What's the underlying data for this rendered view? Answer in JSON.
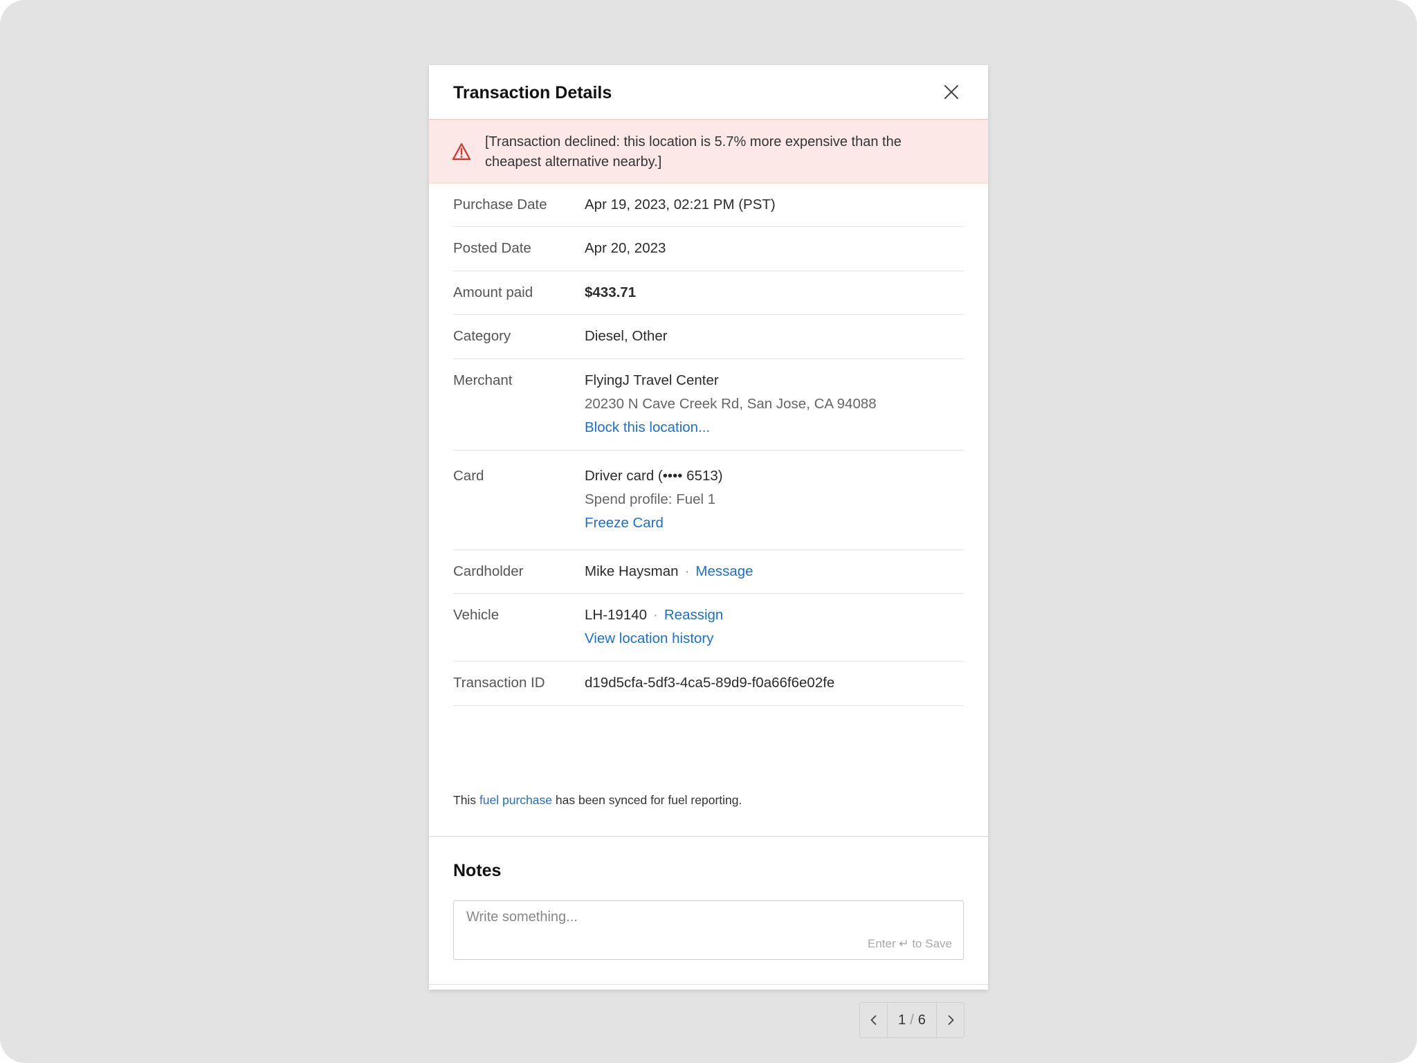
{
  "modal": {
    "title": "Transaction Details",
    "close_icon": "close-icon"
  },
  "alert": {
    "icon": "warning-triangle-icon",
    "text": "[Transaction declined: this location is 5.7% more expensive than the cheapest alternative nearby.]",
    "color": "#d93025"
  },
  "details": {
    "purchase_date": {
      "label": "Purchase Date",
      "value": "Apr 19, 2023, 02:21 PM (PST)"
    },
    "posted_date": {
      "label": "Posted Date",
      "value": "Apr 20, 2023"
    },
    "amount_paid": {
      "label": "Amount paid",
      "value": "$433.71"
    },
    "category": {
      "label": "Category",
      "value": "Diesel, Other"
    },
    "merchant": {
      "label": "Merchant",
      "name": "FlyingJ Travel Center",
      "address": "20230 N Cave Creek Rd, San Jose, CA 94088",
      "block_link": "Block this location..."
    },
    "card": {
      "label": "Card",
      "name": "Driver card (•••• 6513)",
      "spend_profile_label": "Spend profile:",
      "spend_profile_value": "Fuel 1",
      "freeze_link": "Freeze Card"
    },
    "cardholder": {
      "label": "Cardholder",
      "name": "Mike Haysman",
      "separator": "·",
      "message_link": "Message"
    },
    "vehicle": {
      "label": "Vehicle",
      "id": "LH-19140",
      "separator": "·",
      "reassign_link": "Reassign",
      "history_link": "View location history"
    },
    "transaction_id": {
      "label": "Transaction ID",
      "value": "d19d5cfa-5df3-4ca5-89d9-f0a66f6e02fe"
    }
  },
  "sync_note": {
    "prefix": "This",
    "link": "fuel purchase",
    "suffix": "has been synced for fuel reporting."
  },
  "notes": {
    "title": "Notes",
    "placeholder": "Write something...",
    "hint": "Enter ↵ to Save"
  },
  "pager": {
    "current": "1",
    "separator": "/",
    "total": "6",
    "prev_icon": "chevron-left-icon",
    "next_icon": "chevron-right-icon"
  },
  "colors": {
    "link": "#1a6ed8",
    "alert_bg": "#fde8e8",
    "backdrop": "#e3e3e3"
  }
}
